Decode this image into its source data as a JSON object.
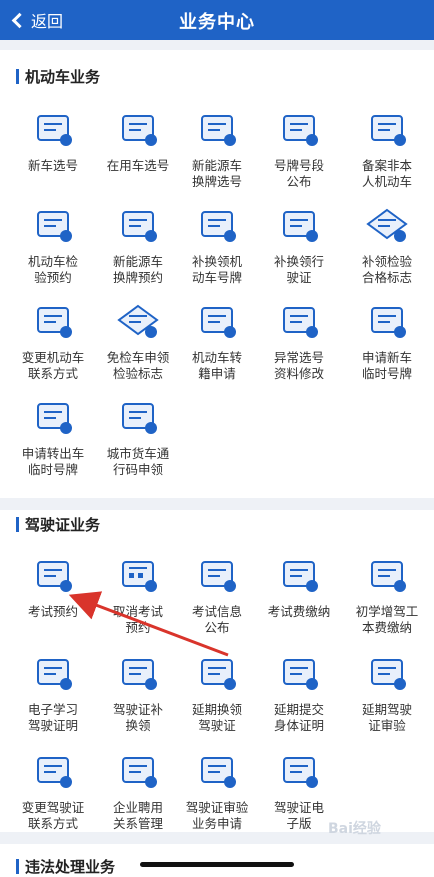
{
  "header": {
    "back_label": "返回",
    "title": "业务中心"
  },
  "sections": [
    {
      "title": "机动车业务",
      "items": [
        {
          "label": "新车选号",
          "icon": "car-doc-icon"
        },
        {
          "label": "在用车选号",
          "icon": "car-swap-icon"
        },
        {
          "label": "新能源车\n换牌选号",
          "icon": "ev-car-icon"
        },
        {
          "label": "号牌号段\n公布",
          "icon": "board-icon"
        },
        {
          "label": "备案非本\n人机动车",
          "icon": "person-doc-icon"
        },
        {
          "label": "机动车检\n验预约",
          "icon": "inspect-book-icon"
        },
        {
          "label": "新能源车\n换牌预约",
          "icon": "plate-book-icon"
        },
        {
          "label": "补换领机\n动车号牌",
          "icon": "plate-replace-icon"
        },
        {
          "label": "补换领行\n驶证",
          "icon": "license-replace-icon"
        },
        {
          "label": "补领检验\n合格标志",
          "icon": "check-diamond-icon"
        },
        {
          "label": "变更机动车\n联系方式",
          "icon": "contact-change-icon"
        },
        {
          "label": "免检车申领\n检验标志",
          "icon": "exempt-diamond-icon"
        },
        {
          "label": "机动车转\n籍申请",
          "icon": "transfer-icon"
        },
        {
          "label": "异常选号\n资料修改",
          "icon": "edit-doc-icon"
        },
        {
          "label": "申请新车\n临时号牌",
          "icon": "temp-plate-icon"
        },
        {
          "label": "申请转出车\n临时号牌",
          "icon": "transfer-out-icon"
        },
        {
          "label": "城市货车通\n行码申领",
          "icon": "truck-pass-icon"
        }
      ]
    },
    {
      "title": "驾驶证业务",
      "items": [
        {
          "label": "考试预约",
          "icon": "exam-book-icon"
        },
        {
          "label": "取消考试\n预约",
          "icon": "calendar-cancel-icon"
        },
        {
          "label": "考试信息\n公布",
          "icon": "exam-info-icon"
        },
        {
          "label": "考试费缴纳",
          "icon": "fee-icon"
        },
        {
          "label": "初学增驾工\n本费缴纳",
          "icon": "id-card-icon"
        },
        {
          "label": "电子学习\n驾驶证明",
          "icon": "study-icon"
        },
        {
          "label": "驾驶证补\n换领",
          "icon": "license-card-icon"
        },
        {
          "label": "延期换领\n驾驶证",
          "icon": "delay-license-icon"
        },
        {
          "label": "延期提交\n身体证明",
          "icon": "health-icon"
        },
        {
          "label": "延期驾驶\n证审验",
          "icon": "review-icon"
        },
        {
          "label": "变更驾驶证\n联系方式",
          "icon": "phone-change-icon"
        },
        {
          "label": "企业聘用\n关系管理",
          "icon": "enterprise-icon"
        },
        {
          "label": "驾驶证审验\n业务申请",
          "icon": "review-apply-icon"
        },
        {
          "label": "驾驶证电\n子版",
          "icon": "e-license-icon"
        }
      ]
    },
    {
      "title": "违法处理业务",
      "items": []
    }
  ],
  "watermark": "Bai经验",
  "colors": {
    "primary": "#1f63c6",
    "icon_fill": "#e9f0fb",
    "arrow": "#d9342b"
  }
}
